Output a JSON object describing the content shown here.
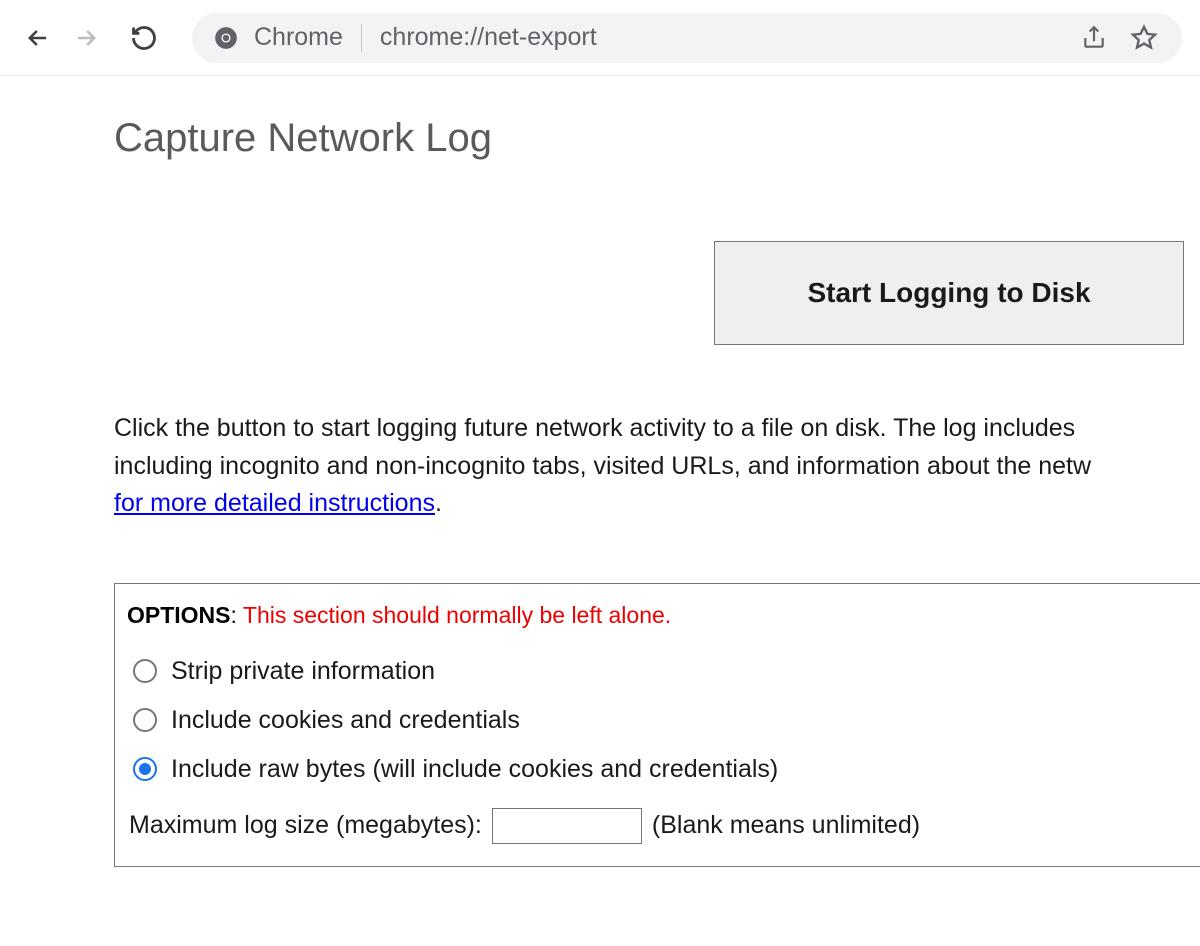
{
  "toolbar": {
    "app_label": "Chrome",
    "url": "chrome://net-export"
  },
  "page": {
    "title": "Capture Network Log",
    "start_button": "Start Logging to Disk",
    "desc_line1": "Click the button to start logging future network activity to a file on disk. The log includes",
    "desc_line2_prefix": "including incognito and non-incognito tabs, visited URLs, and information about the netw",
    "desc_link": "for more detailed instructions",
    "desc_period": "."
  },
  "options": {
    "heading": "OPTIONS",
    "warning": "This section should normally be left alone.",
    "radios": {
      "strip": "Strip private information",
      "cookies": "Include cookies and credentials",
      "raw": "Include raw bytes (will include cookies and credentials)"
    },
    "max_label": "Maximum log size (megabytes):",
    "max_value": "",
    "max_hint": "(Blank means unlimited)"
  }
}
